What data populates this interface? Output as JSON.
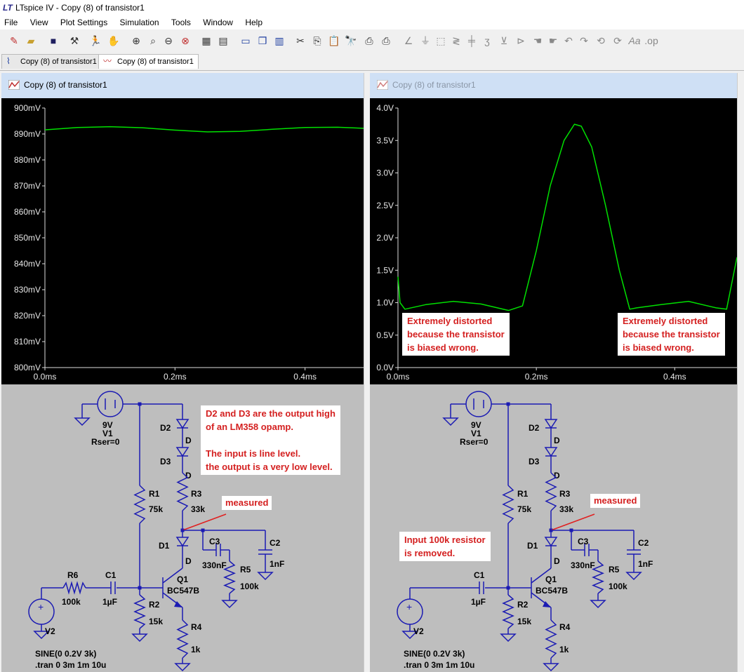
{
  "app": {
    "title": "LTspice IV - Copy (8) of transistor1"
  },
  "menu": [
    "File",
    "View",
    "Plot Settings",
    "Simulation",
    "Tools",
    "Window",
    "Help"
  ],
  "toolbar_icons": [
    "new-schematic",
    "open",
    "save",
    "control-panel",
    "run",
    "halt",
    "zoom-in",
    "pan",
    "zoom-out",
    "zoom-fit",
    "autorange",
    "plot-settings",
    "tile-horizontal",
    "cascade",
    "tile",
    "cut",
    "copy",
    "find",
    "print-preview",
    "print",
    "wire",
    "ground",
    "label",
    "resistor",
    "capacitor",
    "inductor",
    "diode",
    "component",
    "move",
    "drag",
    "undo",
    "redo",
    "rotate",
    "mirror",
    "text",
    "spice-directive"
  ],
  "tabs": [
    {
      "label": "Copy (8) of transistor1",
      "icon": "schematic-icon"
    },
    {
      "label": "Copy (8) of transistor1",
      "icon": "waveform-icon"
    }
  ],
  "panes": [
    {
      "title": "Copy (8) of transistor1",
      "chart_data": {
        "type": "line",
        "ylim": [
          0.8,
          0.9
        ],
        "yticks": [
          "800mV",
          "810mV",
          "820mV",
          "830mV",
          "840mV",
          "850mV",
          "860mV",
          "870mV",
          "880mV",
          "890mV",
          "900mV"
        ],
        "xticks": [
          "0.0ms",
          "0.2ms",
          "0.4ms"
        ],
        "xlim": [
          0,
          0.49
        ],
        "series": [
          {
            "color": "#00e000",
            "x": [
              0,
              0.05,
              0.1,
              0.15,
              0.2,
              0.25,
              0.3,
              0.35,
              0.4,
              0.45,
              0.49
            ],
            "y": [
              0.8916,
              0.8925,
              0.8928,
              0.8924,
              0.8915,
              0.8908,
              0.891,
              0.8918,
              0.8925,
              0.8926,
              0.8922
            ]
          }
        ]
      },
      "schematic": {
        "components": {
          "V1": "V1",
          "V1_val": "9V",
          "V1_rser": "Rser=0",
          "D2": "D2",
          "D3": "D3",
          "D_type": "D",
          "R1": "R1",
          "R1_val": "75k",
          "R3": "R3",
          "R3_val": "33k",
          "D1": "D1",
          "C3": "C3",
          "C3_val": "330nF",
          "C2": "C2",
          "C2_val": "1nF",
          "R5": "R5",
          "R5_val": "100k",
          "Q1": "Q1",
          "Q1_val": "BC547B",
          "R6": "R6",
          "R6_val": "100k",
          "C1": "C1",
          "C1_val": "1µF",
          "R2": "R2",
          "R2_val": "15k",
          "R4": "R4",
          "R4_val": "1k",
          "V2": "V2",
          "sine": "SINE(0 0.2V 3k)",
          "tran": ".tran 0 3m 1m 10u"
        },
        "measured": "measured",
        "note": "D2 and D3 are the output high\nof an LM358 opamp.\n\nThe input is line level.\nthe output is a very low level."
      }
    },
    {
      "title": "Copy (8) of transistor1",
      "chart_data": {
        "type": "line",
        "ylim": [
          0.0,
          4.0
        ],
        "yticks": [
          "0.0V",
          "0.5V",
          "1.0V",
          "1.5V",
          "2.0V",
          "2.5V",
          "3.0V",
          "3.5V",
          "4.0V"
        ],
        "xticks": [
          "0.0ms",
          "0.2ms",
          "0.4ms"
        ],
        "xlim": [
          0,
          0.49
        ],
        "series": [
          {
            "color": "#00e000",
            "x": [
              0,
              0.003,
              0.01,
              0.04,
              0.08,
              0.12,
              0.16,
              0.18,
              0.2,
              0.22,
              0.24,
              0.255,
              0.265,
              0.28,
              0.3,
              0.32,
              0.335,
              0.345,
              0.38,
              0.42,
              0.46,
              0.475,
              0.49
            ],
            "y": [
              1.4,
              1.0,
              0.9,
              0.97,
              1.02,
              0.98,
              0.88,
              0.95,
              1.8,
              2.8,
              3.5,
              3.75,
              3.72,
              3.4,
              2.5,
              1.5,
              0.9,
              0.92,
              0.97,
              1.02,
              0.92,
              0.9,
              1.7
            ]
          }
        ]
      },
      "annotations": [
        "Extremely distorted\nbecause the transistor\nis biased wrong.",
        "Extremely distorted\nbecause the transistor\nis biased wrong."
      ],
      "schematic": {
        "components": {
          "V1": "V1",
          "V1_val": "9V",
          "V1_rser": "Rser=0",
          "D2": "D2",
          "D3": "D3",
          "D_type": "D",
          "R1": "R1",
          "R1_val": "75k",
          "R3": "R3",
          "R3_val": "33k",
          "D1": "D1",
          "C3": "C3",
          "C3_val": "330nF",
          "C2": "C2",
          "C2_val": "1nF",
          "R5": "R5",
          "R5_val": "100k",
          "Q1": "Q1",
          "Q1_val": "BC547B",
          "C1": "C1",
          "C1_val": "1µF",
          "R2": "R2",
          "R2_val": "15k",
          "R4": "R4",
          "R4_val": "1k",
          "V2": "V2",
          "sine": "SINE(0 0.2V 3k)",
          "tran": ".tran 0 3m 1m 10u"
        },
        "measured": "measured",
        "note": "Input 100k resistor\nis removed."
      }
    }
  ]
}
